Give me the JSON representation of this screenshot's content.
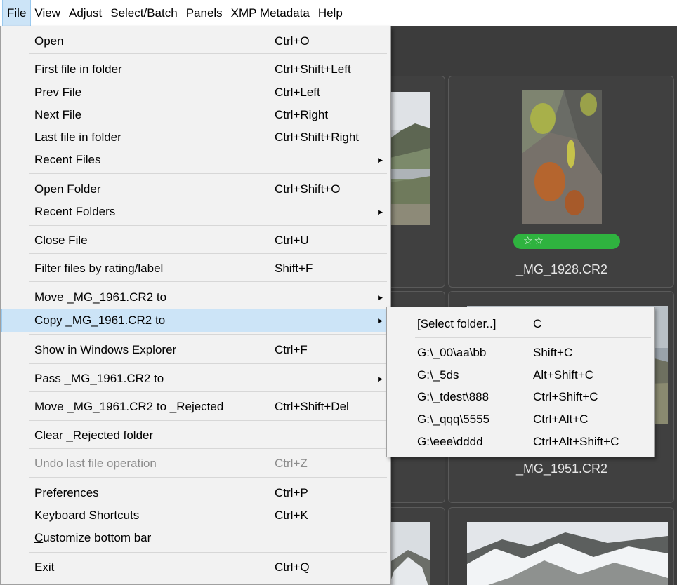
{
  "menubar": {
    "items": [
      {
        "label": "File",
        "accel": "F",
        "rest": "ile"
      },
      {
        "label": "View",
        "accel": "V",
        "rest": "iew"
      },
      {
        "label": "Adjust",
        "accel": "A",
        "rest": "djust"
      },
      {
        "label": "Select/Batch",
        "accel": "S",
        "rest": "elect/Batch"
      },
      {
        "label": "Panels",
        "accel": "P",
        "rest": "anels"
      },
      {
        "label": "XMP Metadata",
        "accel": "X",
        "rest": "MP Metadata"
      },
      {
        "label": "Help",
        "accel": "H",
        "rest": "elp"
      }
    ]
  },
  "file_menu": {
    "open": {
      "label": "Open",
      "shortcut": "Ctrl+O"
    },
    "first_file": {
      "label": "First file in folder",
      "shortcut": "Ctrl+Shift+Left"
    },
    "prev_file": {
      "label": "Prev File",
      "shortcut": "Ctrl+Left"
    },
    "next_file": {
      "label": "Next File",
      "shortcut": "Ctrl+Right"
    },
    "last_file": {
      "label": "Last file in folder",
      "shortcut": "Ctrl+Shift+Right"
    },
    "recent_files": {
      "label": "Recent Files"
    },
    "open_folder": {
      "label": "Open Folder",
      "shortcut": "Ctrl+Shift+O"
    },
    "recent_folders": {
      "label": "Recent Folders"
    },
    "close_file": {
      "label": "Close File",
      "shortcut": "Ctrl+U"
    },
    "filter_files": {
      "label": "Filter files by rating/label",
      "shortcut": "Shift+F"
    },
    "move_to": {
      "label": "Move _MG_1961.CR2 to"
    },
    "copy_to": {
      "label": "Copy _MG_1961.CR2 to"
    },
    "show_in_explorer": {
      "label": "Show in Windows Explorer",
      "shortcut": "Ctrl+F"
    },
    "pass_to": {
      "label": "Pass _MG_1961.CR2 to"
    },
    "move_rejected": {
      "label": "Move _MG_1961.CR2 to _Rejected",
      "shortcut": "Ctrl+Shift+Del"
    },
    "clear_rejected": {
      "label": "Clear _Rejected folder"
    },
    "undo": {
      "label": "Undo last file operation",
      "shortcut": "Ctrl+Z"
    },
    "preferences": {
      "label": "Preferences",
      "shortcut": "Ctrl+P"
    },
    "keyboard_shortcuts": {
      "label": "Keyboard Shortcuts",
      "shortcut": "Ctrl+K"
    },
    "customize_bar": {
      "label": "Customize bottom bar",
      "accel": "C",
      "rest": "ustomize bottom bar"
    },
    "exit": {
      "label": "Exit",
      "pre": "E",
      "accel": "x",
      "rest": "it",
      "shortcut": "Ctrl+Q"
    }
  },
  "copy_submenu": {
    "items": [
      {
        "label": "[Select folder..]",
        "shortcut": "C"
      },
      {
        "label": "G:\\_00\\aa\\bb",
        "shortcut": "Shift+C"
      },
      {
        "label": "G:\\_5ds",
        "shortcut": "Alt+Shift+C"
      },
      {
        "label": "G:\\_tdest\\888",
        "shortcut": "Ctrl+Shift+C"
      },
      {
        "label": "G:\\_qqq\\5555",
        "shortcut": "Ctrl+Alt+C"
      },
      {
        "label": "G:\\eee\\dddd",
        "shortcut": "Ctrl+Alt+Shift+C"
      }
    ]
  },
  "thumbnails": {
    "t1928": {
      "filename": "_MG_1928.CR2",
      "rating": "☆☆",
      "label_color": "#2fb33f"
    },
    "t1951": {
      "filename": "_MG_1951.CR2",
      "rating": "☆☆☆☆",
      "label_color": "#c0302a"
    }
  }
}
